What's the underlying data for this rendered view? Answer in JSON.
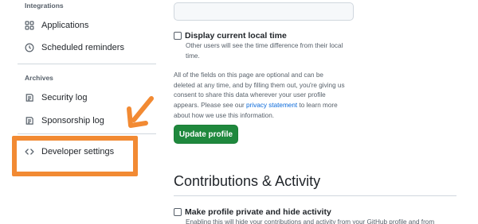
{
  "sidebar": {
    "integrations_heading": "Integrations",
    "integrations": [
      {
        "label": "Applications",
        "icon": "apps-grid-icon"
      },
      {
        "label": "Scheduled reminders",
        "icon": "clock-icon"
      }
    ],
    "archives_heading": "Archives",
    "archives": [
      {
        "label": "Security log",
        "icon": "log-icon"
      },
      {
        "label": "Sponsorship log",
        "icon": "log-icon"
      }
    ],
    "developer_settings": {
      "label": "Developer settings",
      "icon": "code-icon"
    },
    "highlight_color": "#f28a33"
  },
  "main": {
    "local_time": {
      "label": "Display current local time",
      "help_line1": "Other users will see the time difference from their local",
      "help_line2": "time."
    },
    "consent": {
      "line1": "All of the fields on this page are optional and can be",
      "line2": "deleted at any time, and by filling them out, you're giving us",
      "line3": "consent to share this data wherever your user profile",
      "line4_before": "appears. Please see our ",
      "link": "privacy statement",
      "line4_after": " to learn more",
      "line5": "about how we use this information."
    },
    "update_button": "Update profile",
    "button_color": "#1f883d",
    "contributions_title": "Contributions & Activity",
    "private": {
      "label": "Make profile private and hide activity",
      "help": "Enabling this will hide your contributions and activity from your GitHub profile and from"
    }
  }
}
